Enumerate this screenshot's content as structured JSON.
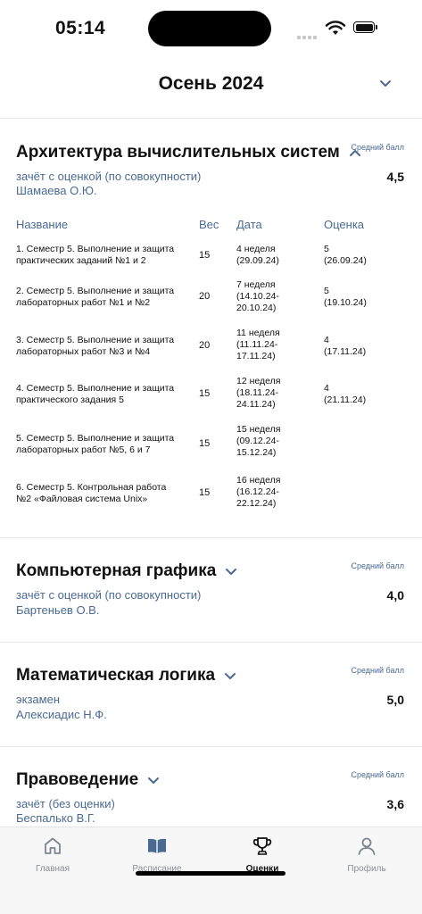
{
  "status_bar": {
    "time": "05:14"
  },
  "semester": {
    "title": "Осень 2024"
  },
  "subjects": [
    {
      "name": "Архитектура вычислительных систем",
      "expanded": true,
      "avg_label": "Средний балл",
      "avg_value": "4,5",
      "type": "зачёт с оценкой (по совокупности)",
      "teacher": "Шамаева О.Ю.",
      "table": {
        "headers": {
          "name": "Название",
          "weight": "Вес",
          "date": "Дата",
          "grade": "Оценка"
        },
        "rows": [
          {
            "name1": "1. Семестр 5. Выполнение и защита",
            "name2": "практических заданий №1 и 2",
            "weight": "15",
            "date1": "4 неделя",
            "date2": "(29.09.24)",
            "date3": "",
            "grade1": "5",
            "grade2": "(26.09.24)"
          },
          {
            "name1": "2. Семестр 5. Выполнение и защита",
            "name2": "лабораторных работ №1 и №2",
            "weight": "20",
            "date1": "7 неделя",
            "date2": "(14.10.24-",
            "date3": "20.10.24)",
            "grade1": "5",
            "grade2": "(19.10.24)"
          },
          {
            "name1": "3. Семестр 5. Выполнение и защита",
            "name2": "лабораторных работ №3 и №4",
            "weight": "20",
            "date1": "11 неделя",
            "date2": "(11.11.24-",
            "date3": "17.11.24)",
            "grade1": "4",
            "grade2": "(17.11.24)"
          },
          {
            "name1": "4. Семестр 5. Выполнение и защита",
            "name2": "практического задания 5",
            "weight": "15",
            "date1": "12 неделя",
            "date2": "(18.11.24-",
            "date3": "24.11.24)",
            "grade1": "4",
            "grade2": "(21.11.24)"
          },
          {
            "name1": "5. Семестр 5. Выполнение и защита",
            "name2": "лабораторных работ №5, 6 и 7",
            "weight": "15",
            "date1": "15 неделя",
            "date2": "(09.12.24-",
            "date3": "15.12.24)",
            "grade1": "",
            "grade2": ""
          },
          {
            "name1": "6. Семестр 5. Контрольная работа",
            "name2": "№2 «Файловая система Unix»",
            "weight": "15",
            "date1": "16 неделя",
            "date2": "(16.12.24-",
            "date3": "22.12.24)",
            "grade1": "",
            "grade2": ""
          }
        ]
      }
    },
    {
      "name": "Компьютерная графика",
      "expanded": false,
      "avg_label": "Средний балл",
      "avg_value": "4,0",
      "type": "зачёт с оценкой (по совокупности)",
      "teacher": "Бартеньев О.В."
    },
    {
      "name": "Математическая логика",
      "expanded": false,
      "avg_label": "Средний балл",
      "avg_value": "5,0",
      "type": "экзамен",
      "teacher": "Алексиадис Н.Ф."
    },
    {
      "name": "Правоведение",
      "expanded": false,
      "avg_label": "Средний балл",
      "avg_value": "3,6",
      "type": "зачёт (без оценки)",
      "teacher": "Беспалько В.Г."
    }
  ],
  "tab_bar": {
    "tabs": [
      {
        "label": "Главная",
        "icon": "home-icon",
        "active": false
      },
      {
        "label": "Расписание",
        "icon": "book-icon",
        "active": false
      },
      {
        "label": "Оценки",
        "icon": "trophy-icon",
        "active": true
      },
      {
        "label": "Профиль",
        "icon": "person-icon",
        "active": false
      }
    ]
  },
  "colors": {
    "accent": "#4a6a93",
    "divider": "#e6e8ec",
    "text": "#111111",
    "inactive_tab": "#8a8f99"
  }
}
